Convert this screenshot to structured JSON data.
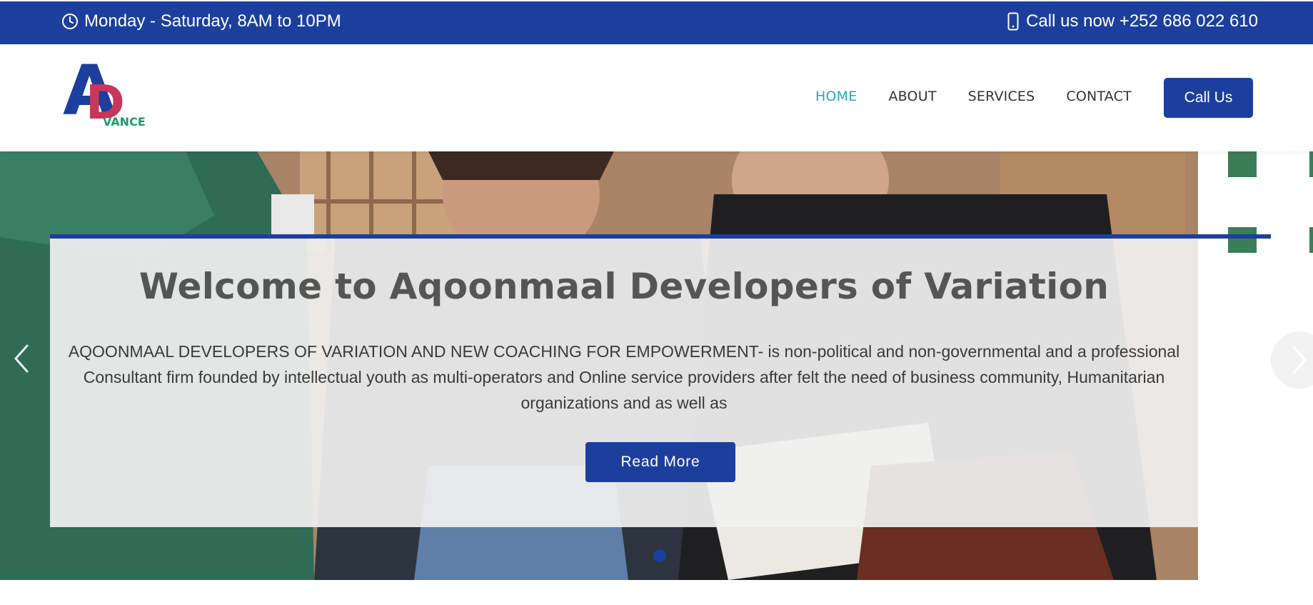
{
  "topbar": {
    "hours_text": "Monday - Saturday, 8AM to 10PM",
    "phone_text": "Call us now +252 686 022 610",
    "hours_icon": "clock-icon",
    "phone_icon": "mobile-phone-icon"
  },
  "logo": {
    "letter_a": "A",
    "letter_d": "D",
    "suffix": "VANCE"
  },
  "nav": {
    "items": [
      {
        "label": "HOME",
        "active": true
      },
      {
        "label": "ABOUT",
        "active": false
      },
      {
        "label": "SERVICES",
        "active": false
      },
      {
        "label": "CONTACT",
        "active": false
      }
    ],
    "cta_label": "Call Us"
  },
  "hero": {
    "title": "Welcome to Aqoonmaal Developers of Variation",
    "description": "AQOONMAAL DEVELOPERS OF VARIATION AND NEW COACHING FOR EMPOWERMENT- is non-political and non-governmental and a professional Consultant firm founded by intellectual youth as multi-operators and Online service providers after felt the need of business community, Humanitarian organizations and as well as",
    "button_label": "Read More",
    "prev_icon": "chevron-left-icon",
    "next_icon": "chevron-right-icon",
    "slide_count": 1,
    "active_slide": 1
  },
  "colors": {
    "brand_blue": "#1c3f9e",
    "nav_active": "#2aa6b8",
    "logo_red": "#c8365a",
    "logo_green": "#1f9a6a",
    "deco_green": "#2e7d4f"
  }
}
